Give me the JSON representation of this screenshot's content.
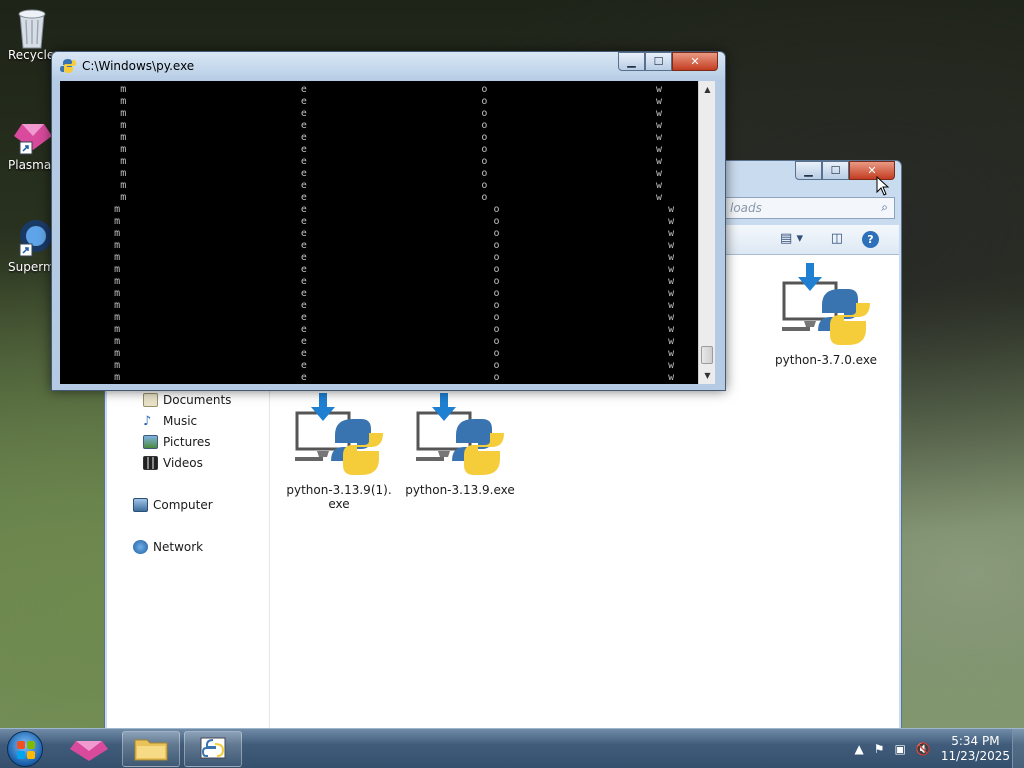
{
  "desktop": {
    "icons": [
      {
        "label": "Recycle",
        "name": "recycle-bin"
      },
      {
        "label": "Plasma",
        "name": "plasma"
      },
      {
        "label": "Superm",
        "name": "superm"
      }
    ]
  },
  "console": {
    "title": "C:\\Windows\\py.exe",
    "lines": [
      "          m                             e                             o                            w",
      "          m                             e                             o                            w",
      "          m                             e                             o                            w",
      "          m                             e                             o                            w",
      "          m                             e                             o                            w",
      "          m                             e                             o                            w",
      "          m                             e                             o                            w",
      "          m                             e                             o                            w",
      "          m                             e                             o                            w",
      "          m                             e                             o                            w",
      "         m                              e                               o                            w",
      "         m                              e                               o                            w",
      "         m                              e                               o                            w",
      "         m                              e                               o                            w",
      "         m                              e                               o                            w",
      "         m                              e                               o                            w",
      "         m                              e                               o                            w",
      "         m                              e                               o                            w",
      "         m                              e                               o                            w",
      "         m                              e                               o                            w",
      "         m                              e                               o                            w",
      "         m                              e                               o                            w",
      "         m                              e                               o                            w",
      "         m                              e                               o                            w",
      "         m                              e                               o                            w"
    ]
  },
  "explorer": {
    "address_partial": "loads",
    "nav": [
      {
        "label": "Documents",
        "icon": "documents-icon"
      },
      {
        "label": "Music",
        "icon": "music-icon"
      },
      {
        "label": "Pictures",
        "icon": "pictures-icon"
      },
      {
        "label": "Videos",
        "icon": "videos-icon"
      },
      {
        "label": "Computer",
        "icon": "computer-icon"
      },
      {
        "label": "Network",
        "icon": "network-icon"
      }
    ],
    "files": [
      {
        "line1": "python-3.13.9(1).",
        "line2": "exe"
      },
      {
        "line1": "python-3.13.9.exe",
        "line2": ""
      },
      {
        "line1": "python-3.7.0.exe",
        "line2": ""
      }
    ]
  },
  "taskbar": {
    "time": "5:34 PM",
    "date": "11/23/2025"
  },
  "colors": {
    "python_blue": "#3a74b0",
    "python_yellow": "#f5cd3a",
    "download_arrow": "#1f7fd1"
  }
}
